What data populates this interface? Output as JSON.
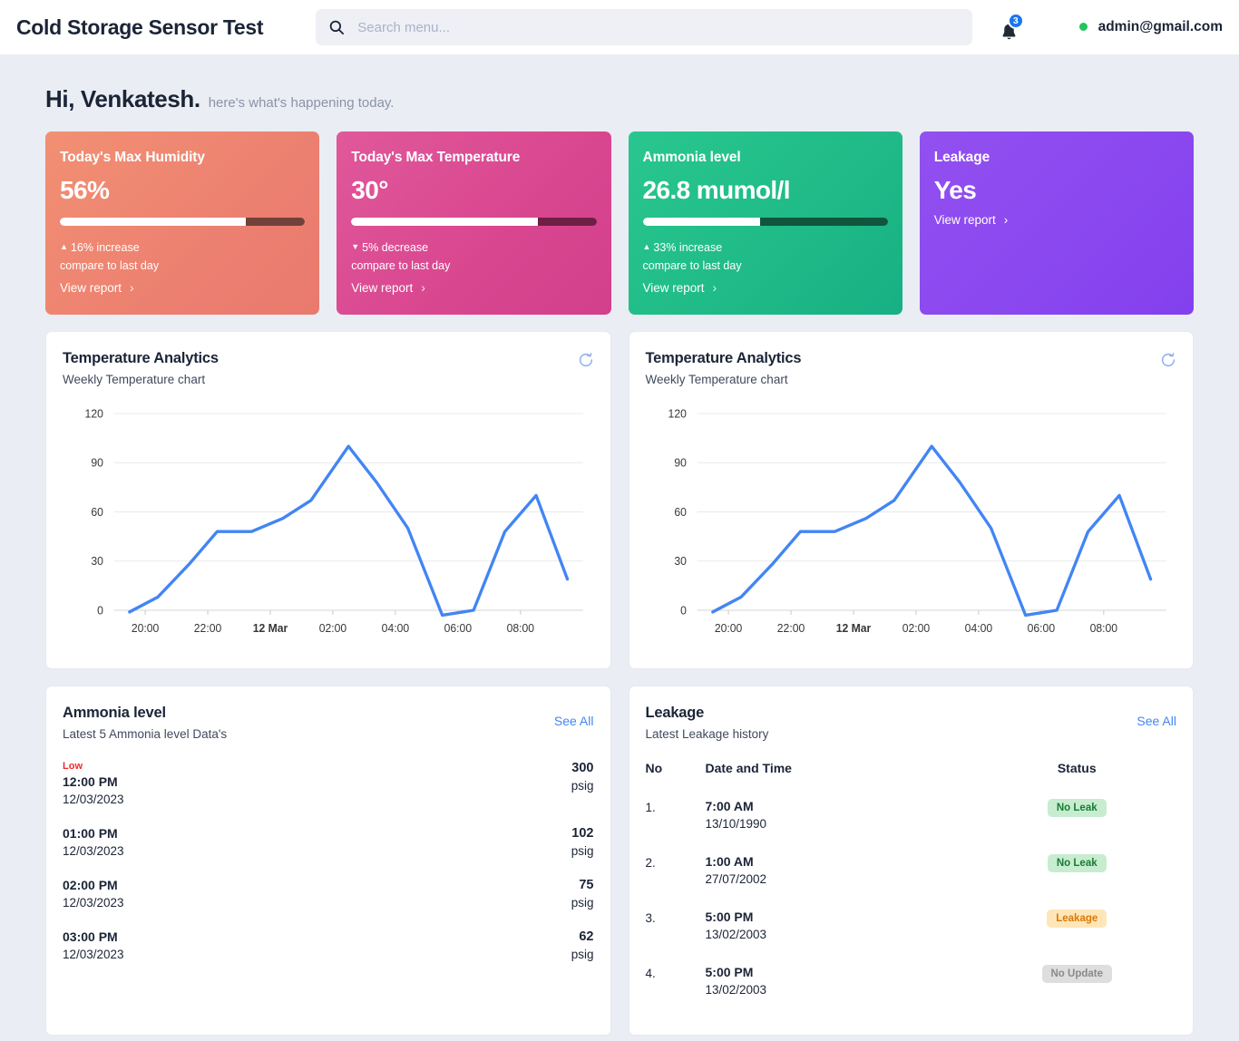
{
  "header": {
    "app_title": "Cold Storage Sensor Test",
    "search": {
      "placeholder": "Search menu...",
      "value": "",
      "icon": "search-icon"
    },
    "notifications": {
      "count": "3",
      "icon": "bell-icon"
    },
    "user": {
      "email": "admin@gmail.com",
      "status": "online"
    }
  },
  "greeting": {
    "main": "Hi, Venkatesh.",
    "sub": "here's what's happening today."
  },
  "kpi_cards": [
    {
      "title": "Today's Max Humidity",
      "value": "56%",
      "bar_percent": 76,
      "delta_caret": "▲",
      "delta": "16% increase",
      "compare": "compare to last day",
      "link": "View report",
      "color": "#ec8070"
    },
    {
      "title": "Today's Max Temperature",
      "value": "30°",
      "bar_percent": 76,
      "delta_caret": "▼",
      "delta": "5% decrease",
      "compare": "compare to last day",
      "link": "View report",
      "color": "#d94690"
    },
    {
      "title": "Ammonia level",
      "value": "26.8 mumol/l",
      "bar_percent": 48,
      "delta_caret": "▲",
      "delta": "33% increase",
      "compare": "compare to last day",
      "link": "View report",
      "color": "#1fba87"
    },
    {
      "title": "Leakage",
      "value": "Yes",
      "link": "View report",
      "color": "#8a47ef"
    }
  ],
  "charts": [
    {
      "title": "Temperature Analytics",
      "subtitle": "Weekly Temperature chart",
      "refresh_icon": "refresh-icon"
    },
    {
      "title": "Temperature Analytics",
      "subtitle": "Weekly Temperature chart",
      "refresh_icon": "refresh-icon"
    }
  ],
  "chart_data": [
    {
      "type": "line",
      "title": "Temperature Analytics",
      "subtitle": "Weekly Temperature chart",
      "xlabel": "",
      "ylabel": "",
      "ylim": [
        0,
        120
      ],
      "yticks": [
        0,
        30,
        60,
        90,
        120
      ],
      "xticks": [
        "20:00",
        "22:00",
        "12 Mar",
        "02:00",
        "04:00",
        "06:00",
        "08:00"
      ],
      "xtick_bold": "12 Mar",
      "grid": true,
      "legend": "none",
      "line_color": "#4285f4",
      "x": [
        19.5,
        20.4,
        21.4,
        22.3,
        23.4,
        0.4,
        1.3,
        2.5,
        3.4,
        4.4,
        5.5,
        6.5,
        7.5,
        8.5,
        9.5
      ],
      "series": [
        {
          "name": "Temperature",
          "values": [
            -1,
            8,
            28,
            48,
            48,
            56,
            67,
            100,
            78,
            50,
            -3,
            0,
            48,
            70,
            19
          ]
        }
      ]
    },
    {
      "type": "line",
      "title": "Temperature Analytics",
      "subtitle": "Weekly Temperature chart",
      "xlabel": "",
      "ylabel": "",
      "ylim": [
        0,
        120
      ],
      "yticks": [
        0,
        30,
        60,
        90,
        120
      ],
      "xticks": [
        "20:00",
        "22:00",
        "12 Mar",
        "02:00",
        "04:00",
        "06:00",
        "08:00"
      ],
      "xtick_bold": "12 Mar",
      "grid": true,
      "legend": "none",
      "line_color": "#4285f4",
      "x": [
        19.5,
        20.4,
        21.4,
        22.3,
        23.4,
        0.4,
        1.3,
        2.5,
        3.4,
        4.4,
        5.5,
        6.5,
        7.5,
        8.5,
        9.5
      ],
      "series": [
        {
          "name": "Temperature",
          "values": [
            -1,
            8,
            28,
            48,
            48,
            56,
            67,
            100,
            78,
            50,
            -3,
            0,
            48,
            70,
            19
          ]
        }
      ]
    }
  ],
  "ammonia_panel": {
    "title": "Ammonia level",
    "subtitle": "Latest 5 Ammonia level Data's",
    "see_all": "See All",
    "rows": [
      {
        "flag": "Low",
        "time": "12:00 PM",
        "date": "12/03/2023",
        "value": "300",
        "unit": "psig"
      },
      {
        "flag": "",
        "time": "01:00 PM",
        "date": "12/03/2023",
        "value": "102",
        "unit": "psig"
      },
      {
        "flag": "",
        "time": "02:00 PM",
        "date": "12/03/2023",
        "value": "75",
        "unit": "psig"
      },
      {
        "flag": "",
        "time": "03:00 PM",
        "date": "12/03/2023",
        "value": "62",
        "unit": "psig"
      }
    ]
  },
  "leakage_panel": {
    "title": "Leakage",
    "subtitle": "Latest Leakage history",
    "see_all": "See All",
    "columns": [
      "No",
      "Date and Time",
      "Status"
    ],
    "rows": [
      {
        "no": "1.",
        "time": "7:00 AM",
        "date": "13/10/1990",
        "status": "No Leak",
        "status_kind": "no-leak"
      },
      {
        "no": "2.",
        "time": "1:00 AM",
        "date": "27/07/2002",
        "status": "No Leak",
        "status_kind": "no-leak"
      },
      {
        "no": "3.",
        "time": "5:00 PM",
        "date": "13/02/2003",
        "status": "Leakage",
        "status_kind": "leakage"
      },
      {
        "no": "4.",
        "time": "5:00 PM",
        "date": "13/02/2003",
        "status": "No Update",
        "status_kind": "no-update"
      }
    ]
  }
}
